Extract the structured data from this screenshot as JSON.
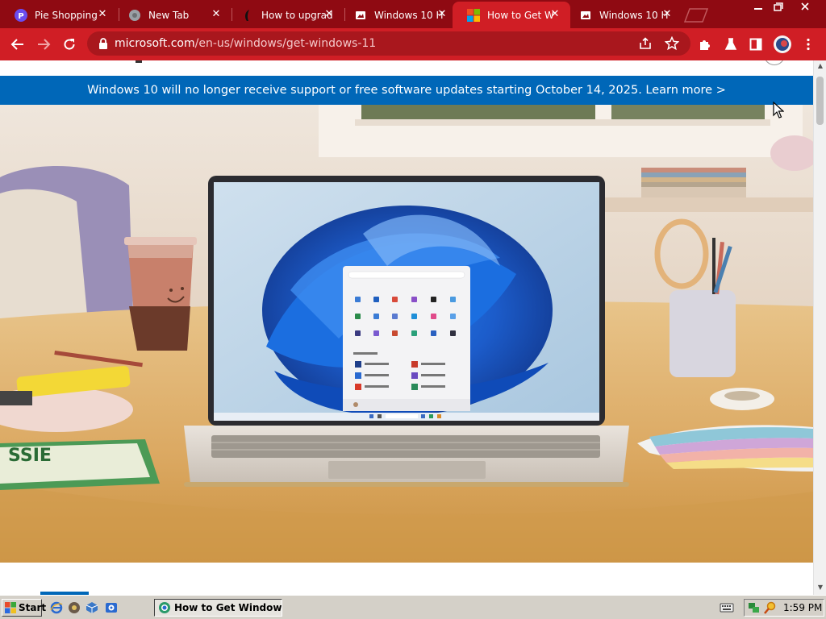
{
  "tabs": [
    {
      "title": "Pie Shopping",
      "favicon": "pie-icon",
      "active": false
    },
    {
      "title": "New Tab",
      "favicon": "globe-icon",
      "active": false
    },
    {
      "title": "How to upgrade",
      "favicon": "feather-icon",
      "active": false
    },
    {
      "title": "Windows 10 H",
      "favicon": "page-icon",
      "active": false
    },
    {
      "title": "How to Get W",
      "favicon": "microsoft-logo-icon",
      "active": true
    },
    {
      "title": "Windows 10 H",
      "favicon": "page-icon",
      "active": false
    }
  ],
  "address_bar": {
    "host": "microsoft.com",
    "path": "/en-us/windows/get-windows-11"
  },
  "page": {
    "banner_text": "Windows 10 will no longer receive support or free software updates starting October 14, 2025. Learn more >"
  },
  "taskbar": {
    "start_label": "Start",
    "active_task": "How to Get Windows...",
    "clock": "1:59 PM"
  },
  "colors": {
    "tabstrip": "#8f0a12",
    "toolbar": "#d01e25",
    "banner": "#0067b8"
  }
}
